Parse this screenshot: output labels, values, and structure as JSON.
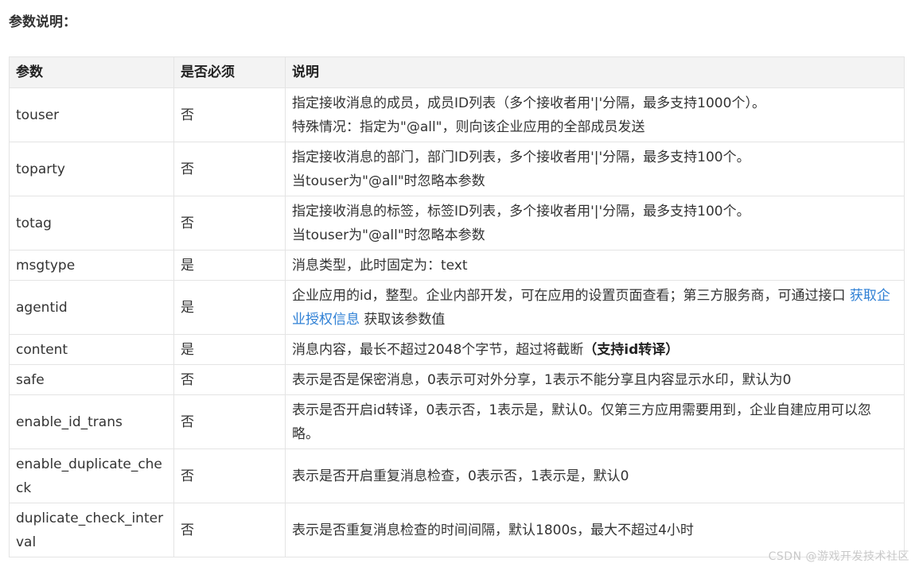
{
  "section_title": "参数说明：",
  "headers": {
    "name": "参数",
    "required": "是否必须",
    "desc": "说明"
  },
  "rows": [
    {
      "name": "touser",
      "required": "否",
      "desc_line1": "指定接收消息的成员，成员ID列表（多个接收者用'|'分隔，最多支持1000个）。",
      "desc_line2": "特殊情况：指定为\"@all\"，则向该企业应用的全部成员发送"
    },
    {
      "name": "toparty",
      "required": "否",
      "desc_line1": "指定接收消息的部门，部门ID列表，多个接收者用'|'分隔，最多支持100个。",
      "desc_line2": "当touser为\"@all\"时忽略本参数"
    },
    {
      "name": "totag",
      "required": "否",
      "desc_line1": "指定接收消息的标签，标签ID列表，多个接收者用'|'分隔，最多支持100个。",
      "desc_line2": "当touser为\"@all\"时忽略本参数"
    },
    {
      "name": "msgtype",
      "required": "是",
      "desc": "消息类型，此时固定为：text"
    },
    {
      "name": "agentid",
      "required": "是",
      "desc_before_link": "企业应用的id，整型。企业内部开发，可在应用的设置页面查看；第三方服务商，可通过接口 ",
      "link_text": "获取企业授权信息",
      "desc_after_link": " 获取该参数值"
    },
    {
      "name": "content",
      "required": "是",
      "desc_main": "消息内容，最长不超过2048个字节，超过将截断",
      "desc_bold": "（支持id转译）"
    },
    {
      "name": "safe",
      "required": "否",
      "desc": "表示是否是保密消息，0表示可对外分享，1表示不能分享且内容显示水印，默认为0"
    },
    {
      "name": "enable_id_trans",
      "required": "否",
      "desc": "表示是否开启id转译，0表示否，1表示是，默认0。仅第三方应用需要用到，企业自建应用可以忽略。"
    },
    {
      "name": "enable_duplicate_check",
      "required": "否",
      "desc": "表示是否开启重复消息检查，0表示否，1表示是，默认0"
    },
    {
      "name": "duplicate_check_interval",
      "required": "否",
      "desc": "表示是否重复消息检查的时间间隔，默认1800s，最大不超过4小时"
    }
  ],
  "watermark": "CSDN @游戏开发技术社区"
}
